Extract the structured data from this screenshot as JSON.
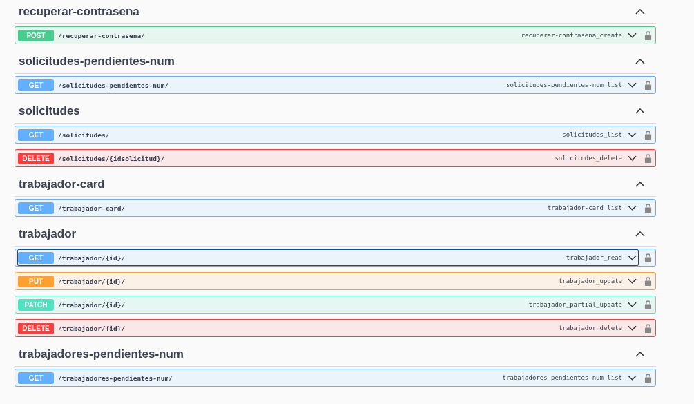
{
  "sections": [
    {
      "title": "recuperar-contrasena",
      "expanded": true,
      "operations": [
        {
          "kind": "post",
          "method": "POST",
          "path": "/recuperar-contrasena/",
          "operation_id": "recuperar-contrasena_create",
          "focused": false
        }
      ]
    },
    {
      "title": "solicitudes-pendientes-num",
      "expanded": true,
      "operations": [
        {
          "kind": "get",
          "method": "GET",
          "path": "/solicitudes-pendientes-num/",
          "operation_id": "solicitudes-pendientes-num_list",
          "focused": false
        }
      ]
    },
    {
      "title": "solicitudes",
      "expanded": true,
      "operations": [
        {
          "kind": "get",
          "method": "GET",
          "path": "/solicitudes/",
          "operation_id": "solicitudes_list",
          "focused": false
        },
        {
          "kind": "delete",
          "method": "DELETE",
          "path": "/solicitudes/{idsolicitud}/",
          "operation_id": "solicitudes_delete",
          "focused": false
        }
      ]
    },
    {
      "title": "trabajador-card",
      "expanded": true,
      "operations": [
        {
          "kind": "get",
          "method": "GET",
          "path": "/trabajador-card/",
          "operation_id": "trabajador-card_list",
          "focused": false
        }
      ]
    },
    {
      "title": "trabajador",
      "expanded": true,
      "operations": [
        {
          "kind": "get",
          "method": "GET",
          "path": "/trabajador/{id}/",
          "operation_id": "trabajador_read",
          "focused": true
        },
        {
          "kind": "put",
          "method": "PUT",
          "path": "/trabajador/{id}/",
          "operation_id": "trabajador_update",
          "focused": false
        },
        {
          "kind": "patch",
          "method": "PATCH",
          "path": "/trabajador/{id}/",
          "operation_id": "trabajador_partial_update",
          "focused": false
        },
        {
          "kind": "delete",
          "method": "DELETE",
          "path": "/trabajador/{id}/",
          "operation_id": "trabajador_delete",
          "focused": false
        }
      ]
    },
    {
      "title": "trabajadores-pendientes-num",
      "expanded": true,
      "operations": [
        {
          "kind": "get",
          "method": "GET",
          "path": "/trabajadores-pendientes-num/",
          "operation_id": "trabajadores-pendientes-num_list",
          "focused": false
        }
      ]
    }
  ]
}
